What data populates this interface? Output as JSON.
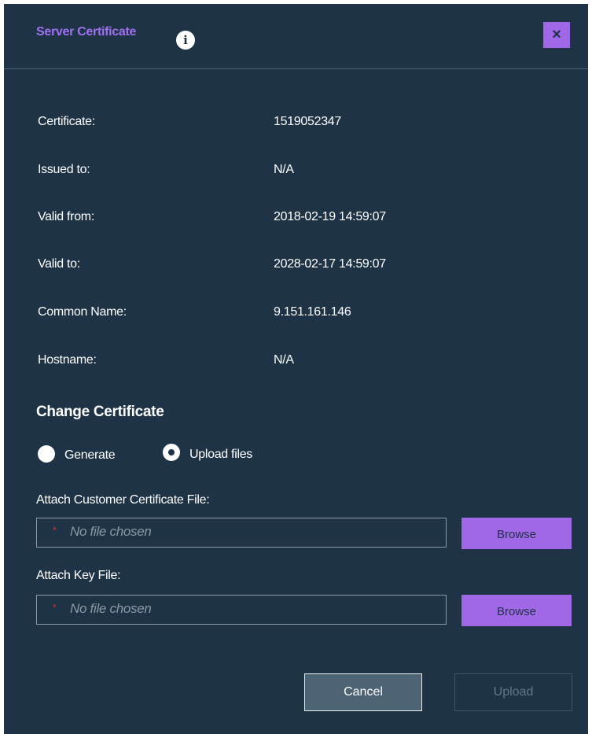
{
  "dialog": {
    "title": "Server Certificate",
    "info_icon": "info-icon",
    "close_icon": "close-icon",
    "close_label": "×"
  },
  "details": [
    {
      "label": "Certificate:",
      "value": "1519052347"
    },
    {
      "label": "Issued to:",
      "value": "N/A"
    },
    {
      "label": "Valid from:",
      "value": "2018-02-19 14:59:07"
    },
    {
      "label": "Valid to:",
      "value": "2028-02-17 14:59:07"
    },
    {
      "label": "Common Name:",
      "value": "9.151.161.146"
    },
    {
      "label": "Hostname:",
      "value": "N/A"
    }
  ],
  "change": {
    "title": "Change Certificate",
    "options": [
      {
        "label": "Generate",
        "selected": false
      },
      {
        "label": "Upload files",
        "selected": true
      }
    ]
  },
  "uploads": [
    {
      "label": "Attach Customer Certificate File:",
      "placeholder": "No file chosen",
      "required_mark": "*",
      "button": "Browse"
    },
    {
      "label": "Attach Key File:",
      "placeholder": "No file chosen",
      "required_mark": "*",
      "button": "Browse"
    }
  ],
  "footer": {
    "cancel": "Cancel",
    "upload": "Upload"
  },
  "colors": {
    "background": "#1e3346",
    "accent": "#a067e6",
    "title": "#a070f0",
    "required": "#e0302a"
  }
}
